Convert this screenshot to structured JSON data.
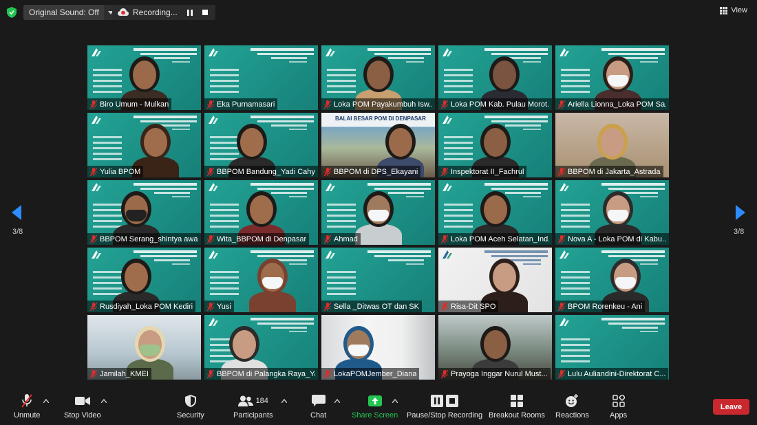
{
  "topbar": {
    "original_sound": "Original Sound: Off",
    "recording": "Recording...",
    "view": "View"
  },
  "pager": {
    "left": "3/8",
    "right": "3/8"
  },
  "participants": [
    "Biro Umum - Mulkan",
    "Eka Purnamasari",
    "Loka POM Payakumbuh Isw...",
    "Loka POM Kab. Pulau Morot...",
    "Ariella Lionna_Loka POM Sa...",
    "Yulia BPOM",
    "BBPOM Bandung_Yadi Cahy...",
    "BBPOM di DPS_Ekayani",
    "Inspektorat II_Fachrul",
    "BBPOM di Jakarta_Astrada",
    "BBPOM Serang_shintya awa...",
    "Wita_BBPOM di Denpasar",
    "Ahmad",
    "Loka POM Aceh Selatan_Ind...",
    "Nova A - Loka POM di Kabu...",
    "Rusdiyah_Loka POM Kediri",
    "Yusi",
    "Sella _Ditwas OT dan SK",
    "Risa-Dit SPO",
    "BPOM Rorenkeu - Ani",
    "Jamilah_KMEI",
    "BBPOM di Palangka Raya_Ya...",
    "LokaPOMJember_Diana",
    "Prayoga Inggar Nurul Must...",
    "Lulu Auliandini-Direktorat C..."
  ],
  "slide_text": {
    "denpasar_banner": "BALAI BESAR POM DI DENPASAR"
  },
  "toolbar": {
    "unmute": "Unmute",
    "stop_video": "Stop Video",
    "security": "Security",
    "participants": "Participants",
    "participants_count": "184",
    "chat": "Chat",
    "share_screen": "Share Screen",
    "pause_stop_recording": "Pause/Stop Recording",
    "breakout_rooms": "Breakout Rooms",
    "reactions": "Reactions",
    "apps": "Apps",
    "leave": "Leave"
  },
  "colors": {
    "share_green": "#23c552",
    "leave_red": "#c8282e",
    "slide_teal": "#1f8e84",
    "mic_muted_red": "#e02b2b",
    "arrow_blue": "#2d8cff"
  }
}
